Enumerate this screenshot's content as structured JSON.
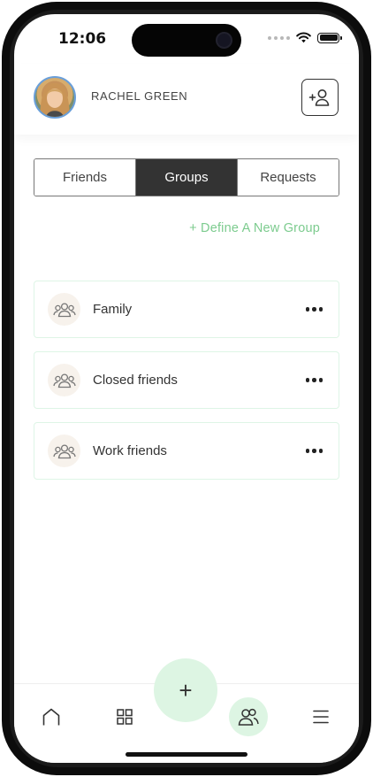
{
  "status_bar": {
    "time": "12:06"
  },
  "header": {
    "user_name": "RACHEL GREEN",
    "avatar_icon": "avatar",
    "add_user_icon": "add-user-icon"
  },
  "tabs": [
    {
      "label": "Friends",
      "active": false
    },
    {
      "label": "Groups",
      "active": true
    },
    {
      "label": "Requests",
      "active": false
    }
  ],
  "define_group_link": "+ Define A New Group",
  "groups": [
    {
      "name": "Family",
      "icon": "group-icon"
    },
    {
      "name": "Closed friends",
      "icon": "group-icon"
    },
    {
      "name": "Work friends",
      "icon": "group-icon"
    }
  ],
  "bottom_nav": {
    "fab_label": "+",
    "items": [
      "home-icon",
      "grid-icon",
      "friends-icon",
      "menu-icon"
    ],
    "active": "friends-icon"
  },
  "colors": {
    "accent_green": "#7ccb8e",
    "accent_green_light": "#ddf5e3",
    "tab_active_bg": "#333333"
  }
}
